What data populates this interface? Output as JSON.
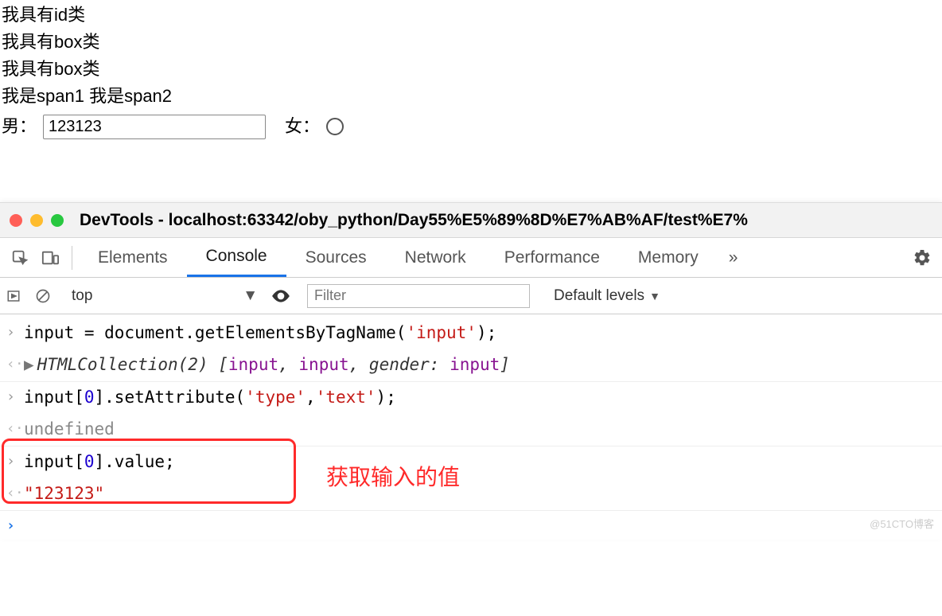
{
  "page": {
    "line1": "我具有id类",
    "line2": "我具有box类",
    "line3": "我具有box类",
    "span1": "我是span1",
    "span2": "我是span2",
    "male_label": "男：",
    "female_label": "女：",
    "input_value": "123123"
  },
  "devtools": {
    "title_prefix": "DevTools - ",
    "title_url": "localhost:63342/oby_python/Day55%E5%89%8D%E7%AB%AF/test%E7%",
    "tabs": {
      "elements": "Elements",
      "console": "Console",
      "sources": "Sources",
      "network": "Network",
      "performance": "Performance",
      "memory": "Memory",
      "more": "»"
    },
    "toolbar": {
      "context": "top",
      "filter_placeholder": "Filter",
      "levels": "Default levels"
    },
    "console": {
      "l1_pre": "input = document.getElementsByTagName(",
      "l1_str": "'input'",
      "l1_post": ");",
      "l2_label": "HTMLCollection(2)",
      "l2_open": " [",
      "l2_a": "input",
      "l2_sep1": ", ",
      "l2_b": "input",
      "l2_sep2": ", ",
      "l2_key": "gender: ",
      "l2_c": "input",
      "l2_close": "]",
      "l3_pre": "input[",
      "l3_idx": "0",
      "l3_mid": "].setAttribute(",
      "l3_s1": "'type'",
      "l3_s2": "'text'",
      "l3_post": ");",
      "l4": "undefined",
      "l5_pre": "input[",
      "l5_idx": "0",
      "l5_post": "].value;",
      "l6": "\"123123\""
    },
    "annotation": "获取输入的值",
    "watermark": "@51CTO博客"
  }
}
